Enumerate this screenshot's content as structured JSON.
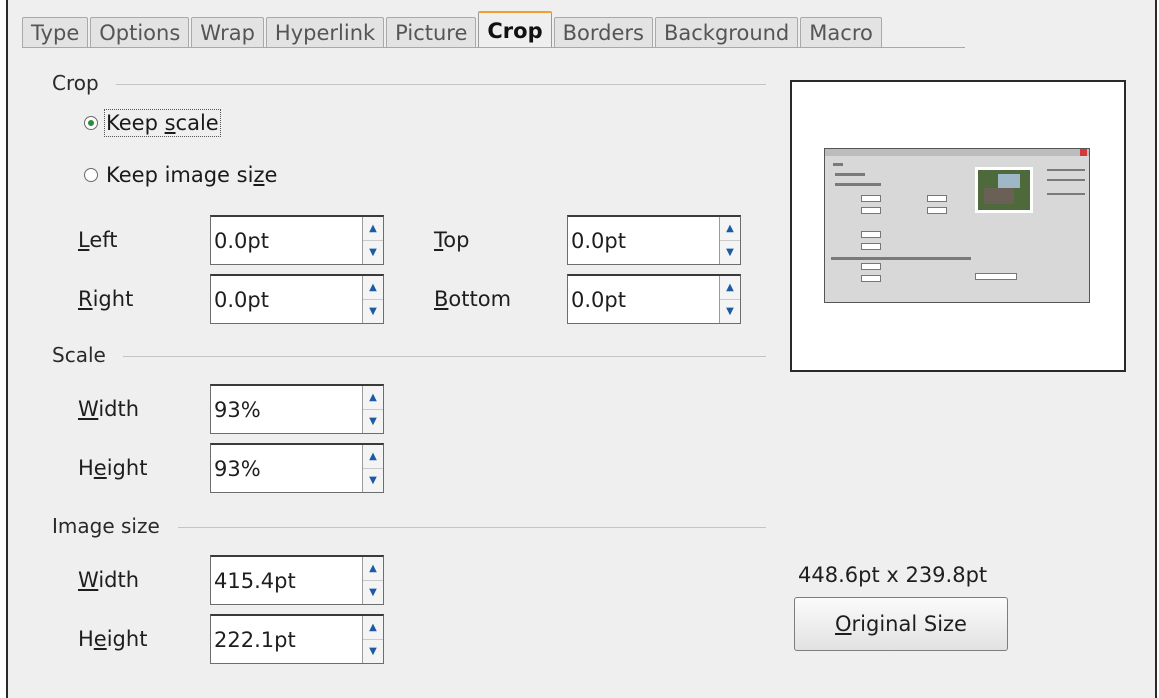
{
  "tabs": [
    "Type",
    "Options",
    "Wrap",
    "Hyperlink",
    "Picture",
    "Crop",
    "Borders",
    "Background",
    "Macro"
  ],
  "active_tab": "Crop",
  "crop": {
    "title": "Crop",
    "keep_scale": {
      "before": "Keep ",
      "key": "s",
      "after": "cale"
    },
    "keep_image_size": {
      "before": "Keep image si",
      "key": "z",
      "after": "e"
    },
    "left": {
      "key": "L",
      "rest": "eft",
      "value": "0.0pt"
    },
    "top": {
      "key": "T",
      "rest": "op",
      "value": "0.0pt"
    },
    "right": {
      "key": "R",
      "rest": "ight",
      "value": "0.0pt"
    },
    "bottom": {
      "key": "B",
      "rest": "ottom",
      "value": "0.0pt"
    }
  },
  "scale": {
    "title": "Scale",
    "width": {
      "key": "W",
      "rest": "idth",
      "value": "93%"
    },
    "height": {
      "before": "H",
      "key": "e",
      "after": "ight",
      "value": "93%"
    }
  },
  "image_size": {
    "title": "Image size",
    "width": {
      "key": "W",
      "rest": "idth",
      "value": "415.4pt"
    },
    "height": {
      "before": "H",
      "key": "e",
      "after": "ight",
      "value": "222.1pt"
    },
    "original_dimensions": "448.6pt x 239.8pt",
    "original_size_button": {
      "key": "O",
      "rest": "riginal Size"
    }
  },
  "colors": {
    "tab_accent": "#f0a030",
    "radio_dot": "#2b8a3e",
    "spin_arrow": "#1c5aa6"
  }
}
